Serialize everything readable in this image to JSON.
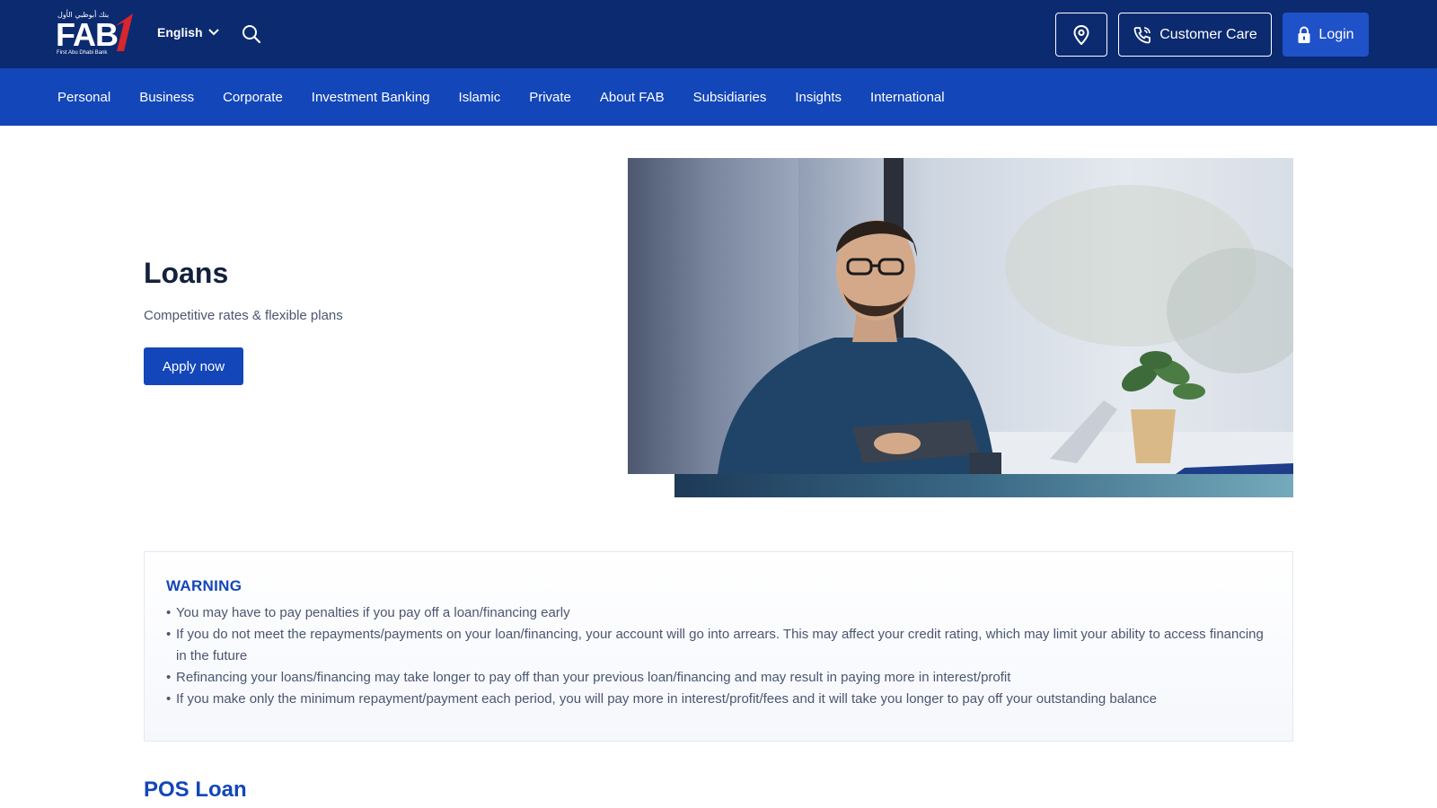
{
  "header": {
    "logo": {
      "arabic_text": "بنك أبوظبي الأول",
      "word": "FAB",
      "subtitle": "First Abu Dhabi Bank"
    },
    "language": "English",
    "icons": {
      "search": "search-icon",
      "location": "location-pin-icon",
      "phone": "phone-icon",
      "lock": "lock-icon",
      "chevron": "chevron-down-icon"
    },
    "customer_care_label": "Customer Care",
    "login_label": "Login"
  },
  "nav": {
    "items": [
      {
        "label": "Personal"
      },
      {
        "label": "Business"
      },
      {
        "label": "Corporate"
      },
      {
        "label": "Investment Banking"
      },
      {
        "label": "Islamic"
      },
      {
        "label": "Private"
      },
      {
        "label": "About FAB"
      },
      {
        "label": "Subsidiaries"
      },
      {
        "label": "Insights"
      },
      {
        "label": "International"
      }
    ]
  },
  "hero": {
    "title": "Loans",
    "subtitle": "Competitive rates & flexible plans",
    "cta_label": "Apply now"
  },
  "warning": {
    "title": "WARNING",
    "items": [
      "You may have to pay penalties if you pay off a loan/financing early",
      "If you do not meet the repayments/payments on your loan/financing, your account will go into arrears. This may affect your credit rating, which may limit your ability to access financing in the future",
      "Refinancing your loans/financing may take longer to pay off than your previous loan/financing and may result in paying more in interest/profit",
      "If you make only the minimum repayment/payment each period, you will pay more in interest/profit/fees and it will take you longer to pay off your outstanding balance"
    ]
  },
  "next_section": {
    "title": "POS Loan"
  },
  "colors": {
    "topbar": "#0b2a6f",
    "navbar": "#1346b8",
    "accent_red": "#d7262e",
    "button_blue": "#1346b8"
  }
}
